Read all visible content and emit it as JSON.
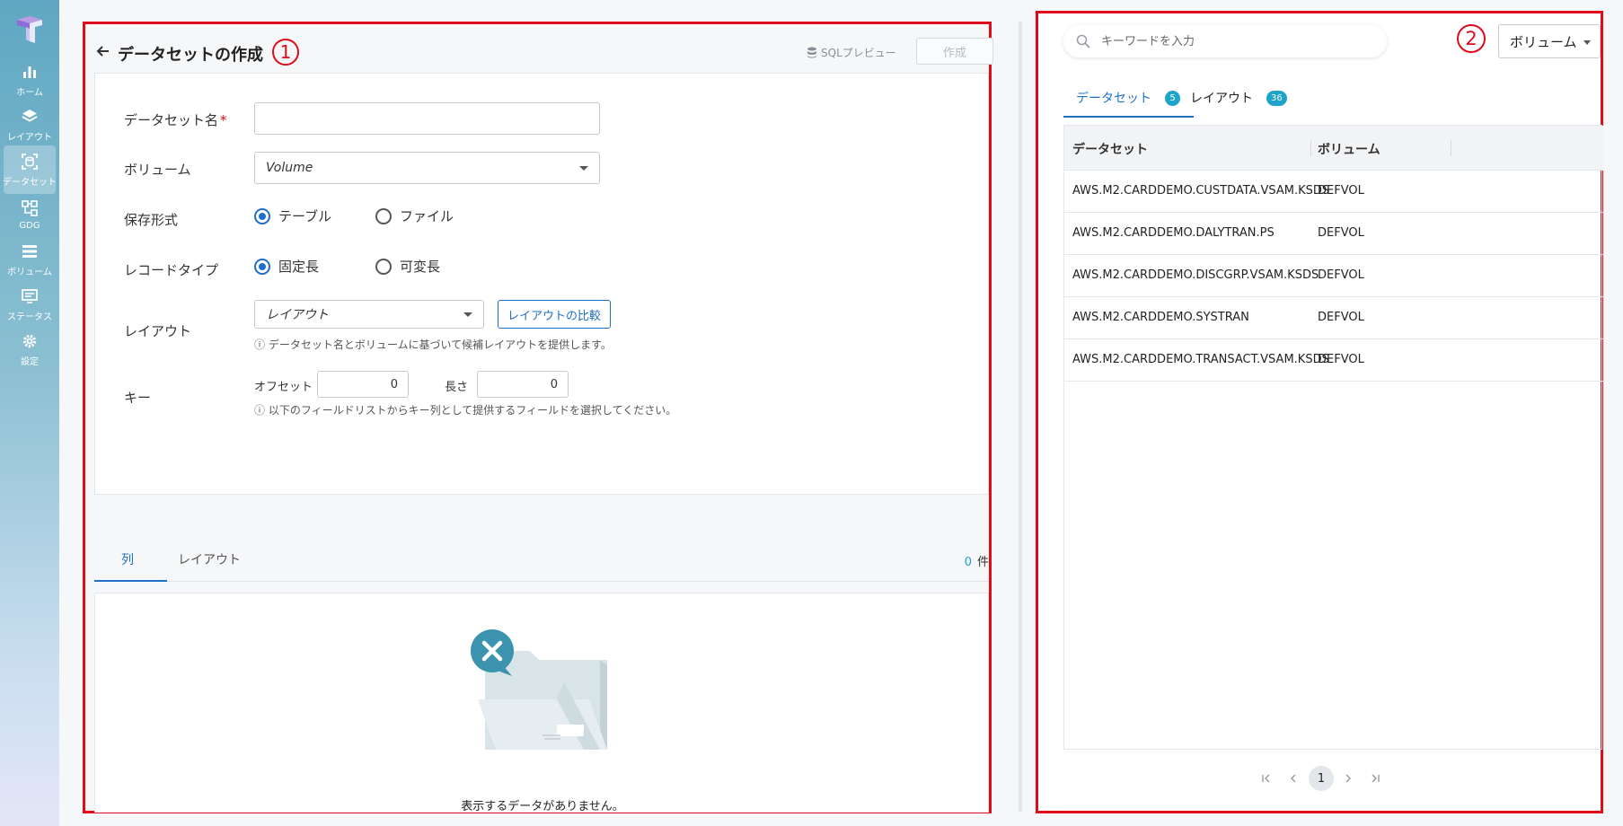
{
  "sidebar": {
    "items": [
      {
        "label": "ホーム",
        "icon": "chart-bar-icon"
      },
      {
        "label": "レイアウト",
        "icon": "layers-icon"
      },
      {
        "label": "データセット",
        "icon": "dataset-icon",
        "active": true
      },
      {
        "label": "GDG",
        "icon": "hierarchy-icon"
      },
      {
        "label": "ボリューム",
        "icon": "volume-list-icon"
      },
      {
        "label": "ステータス",
        "icon": "monitor-icon"
      },
      {
        "label": "設定",
        "icon": "gear-icon"
      }
    ]
  },
  "left": {
    "title": "データセットの作成",
    "marker": "1",
    "sql_preview": "SQLプレビュー",
    "create_button": "作成",
    "form": {
      "dataset_name_label": "データセット名",
      "required_mark": "*",
      "dataset_name_value": "",
      "volume_label": "ボリューム",
      "volume_value": "Volume",
      "storage_format_label": "保存形式",
      "storage_options": [
        "テーブル",
        "ファイル"
      ],
      "storage_selected": "テーブル",
      "record_type_label": "レコードタイプ",
      "record_options": [
        "固定長",
        "可変長"
      ],
      "record_selected": "固定長",
      "layout_label": "レイアウト",
      "layout_value": "レイアウト",
      "compare_button": "レイアウトの比較",
      "layout_hint": "ⓘ データセット名とボリュームに基づいて候補レイアウトを提供します。",
      "key_label": "キー",
      "offset_label": "オフセット",
      "offset_value": "0",
      "length_label": "長さ",
      "length_value": "0",
      "key_hint": "ⓘ 以下のフィールドリストからキー列として提供するフィールドを選択してください。"
    },
    "tabs": [
      "列",
      "レイアウト"
    ],
    "count_value": "0",
    "count_unit": "件",
    "empty_text": "表示するデータがありません。"
  },
  "right": {
    "marker": "2",
    "search_placeholder": "キーワードを入力",
    "volume_filter": "ボリューム",
    "tabs": [
      {
        "label": "データセット",
        "badge": "5"
      },
      {
        "label": "レイアウト",
        "badge": "36"
      }
    ],
    "table": {
      "headers": [
        "データセット",
        "ボリューム"
      ],
      "rows": [
        [
          "AWS.M2.CARDDEMO.CUSTDATA.VSAM.KSDS",
          "DEFVOL"
        ],
        [
          "AWS.M2.CARDDEMO.DALYTRAN.PS",
          "DEFVOL"
        ],
        [
          "AWS.M2.CARDDEMO.DISCGRP.VSAM.KSDS",
          "DEFVOL"
        ],
        [
          "AWS.M2.CARDDEMO.SYSTRAN",
          "DEFVOL"
        ],
        [
          "AWS.M2.CARDDEMO.TRANSACT.VSAM.KSDS",
          "DEFVOL"
        ]
      ]
    },
    "pagination": {
      "current": "1"
    }
  },
  "colors": {
    "accent": "#1f6fc7",
    "badge": "#1fa4c9",
    "highlight_border": "#e00c1c"
  }
}
